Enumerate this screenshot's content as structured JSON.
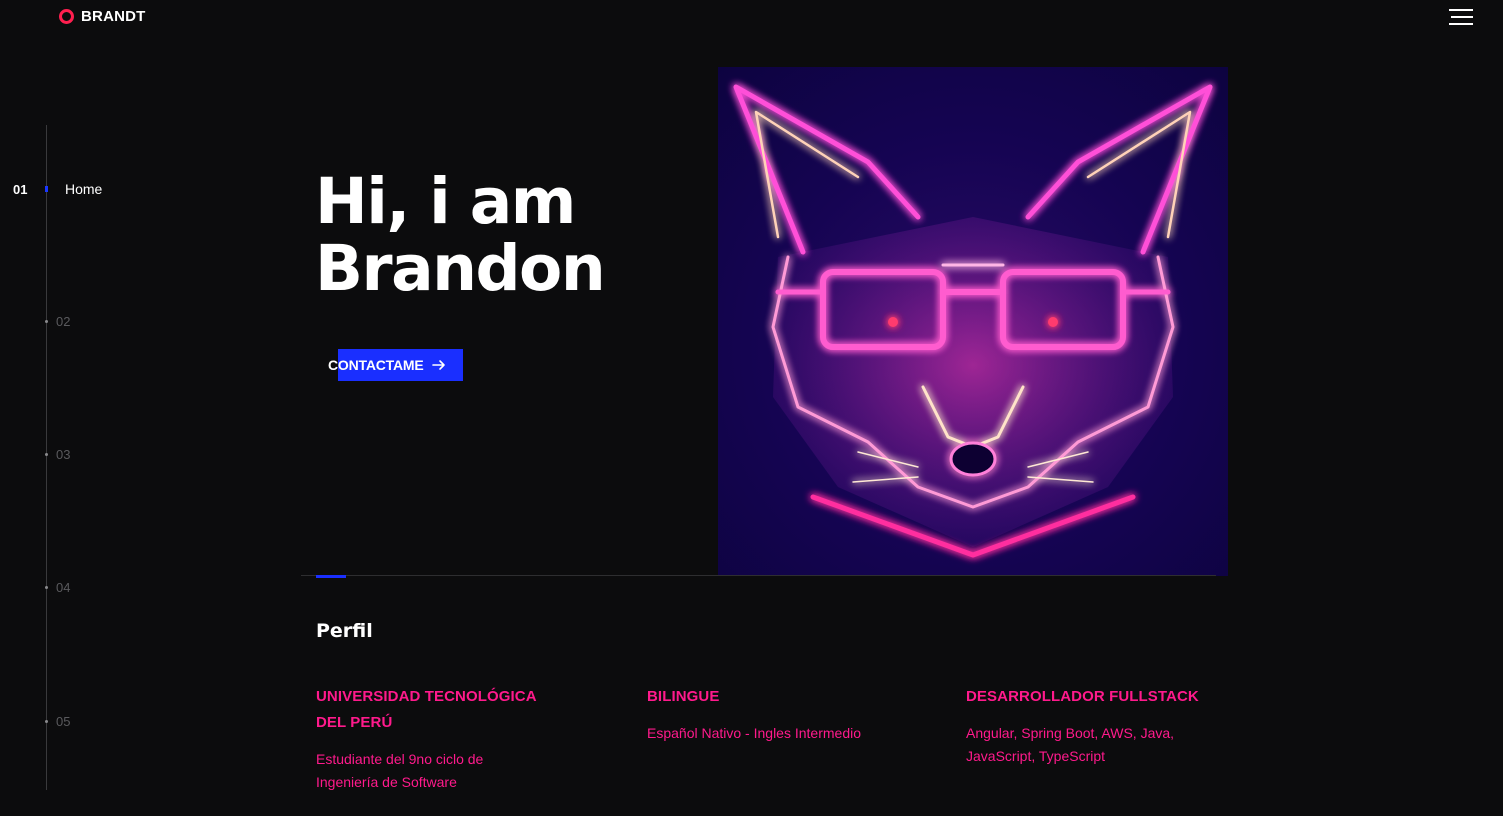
{
  "header": {
    "brand": "BRANDT",
    "menu_icon": "hamburger-menu-icon"
  },
  "sidebar": {
    "active": {
      "number": "01",
      "label": "Home"
    },
    "items": [
      {
        "number": "02"
      },
      {
        "number": "03"
      },
      {
        "number": "04"
      },
      {
        "number": "05"
      }
    ]
  },
  "hero": {
    "title_line1": "Hi, i am",
    "title_line2": "Brandon",
    "cta_label": "CONTACTAME",
    "cta_icon": "arrow-right-icon"
  },
  "profile": {
    "title": "Perfil",
    "columns": [
      {
        "heading": [
          "UNIVERSIDAD TECNOLÓGICA",
          "DEL PERÚ"
        ],
        "body": [
          "Estudiante del 9no ciclo de",
          "Ingeniería de Software"
        ]
      },
      {
        "heading": [
          "BILINGUE"
        ],
        "body": [
          "Español Nativo - Ingles Intermedio"
        ]
      },
      {
        "heading": [
          "DESARROLLADOR FULLSTACK"
        ],
        "body": [
          "Angular, Spring Boot, AWS, Java,",
          "JavaScript, TypeScript"
        ]
      }
    ]
  },
  "colors": {
    "background": "#0c0c0d",
    "accent_blue": "#1a2fff",
    "accent_pink": "#ff1a8c",
    "logo_red": "#ff1f4f"
  }
}
